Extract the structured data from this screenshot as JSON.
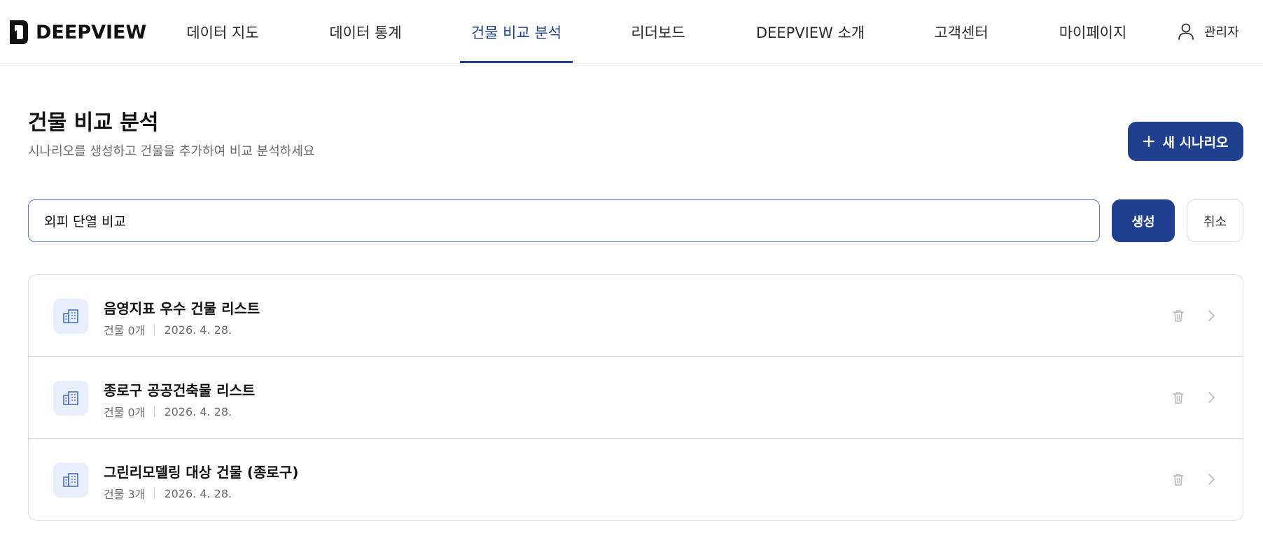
{
  "header": {
    "logo_text": "DEEPVIEW",
    "nav": [
      {
        "label": "데이터 지도"
      },
      {
        "label": "데이터 통계"
      },
      {
        "label": "건물 비교 분석"
      },
      {
        "label": "리더보드"
      },
      {
        "label": "DEEPVIEW 소개"
      },
      {
        "label": "고객센터"
      },
      {
        "label": "마이페이지"
      }
    ],
    "active_nav": "건물 비교 분석",
    "user_label": "관리자",
    "user_icon": "user-icon"
  },
  "page": {
    "title": "건물 비교 분석",
    "subtitle": "시나리오를 생성하고 건물을 추가하여 비교 분석하세요",
    "new_button_label": "새 시나리오",
    "new_button_icon": "plus-icon"
  },
  "create_form": {
    "input_value": "외피 단열 비교",
    "create_label": "생성",
    "cancel_label": "취소"
  },
  "scenarios": [
    {
      "title": "음영지표 우수 건물 리스트",
      "count": "건물 0개",
      "date": "2026. 4. 28."
    },
    {
      "title": "종로구 공공건축물 리스트",
      "count": "건물 0개",
      "date": "2026. 4. 28."
    },
    {
      "title": "그린리모델링 대상 건물 (종로구)",
      "count": "건물 3개",
      "date": "2026. 4. 28."
    }
  ],
  "colors": {
    "primary": "#1f3f8f",
    "input_border": "#5b79d6",
    "icon_bg": "#e8eefb",
    "icon_fg": "#4a6fc9"
  }
}
